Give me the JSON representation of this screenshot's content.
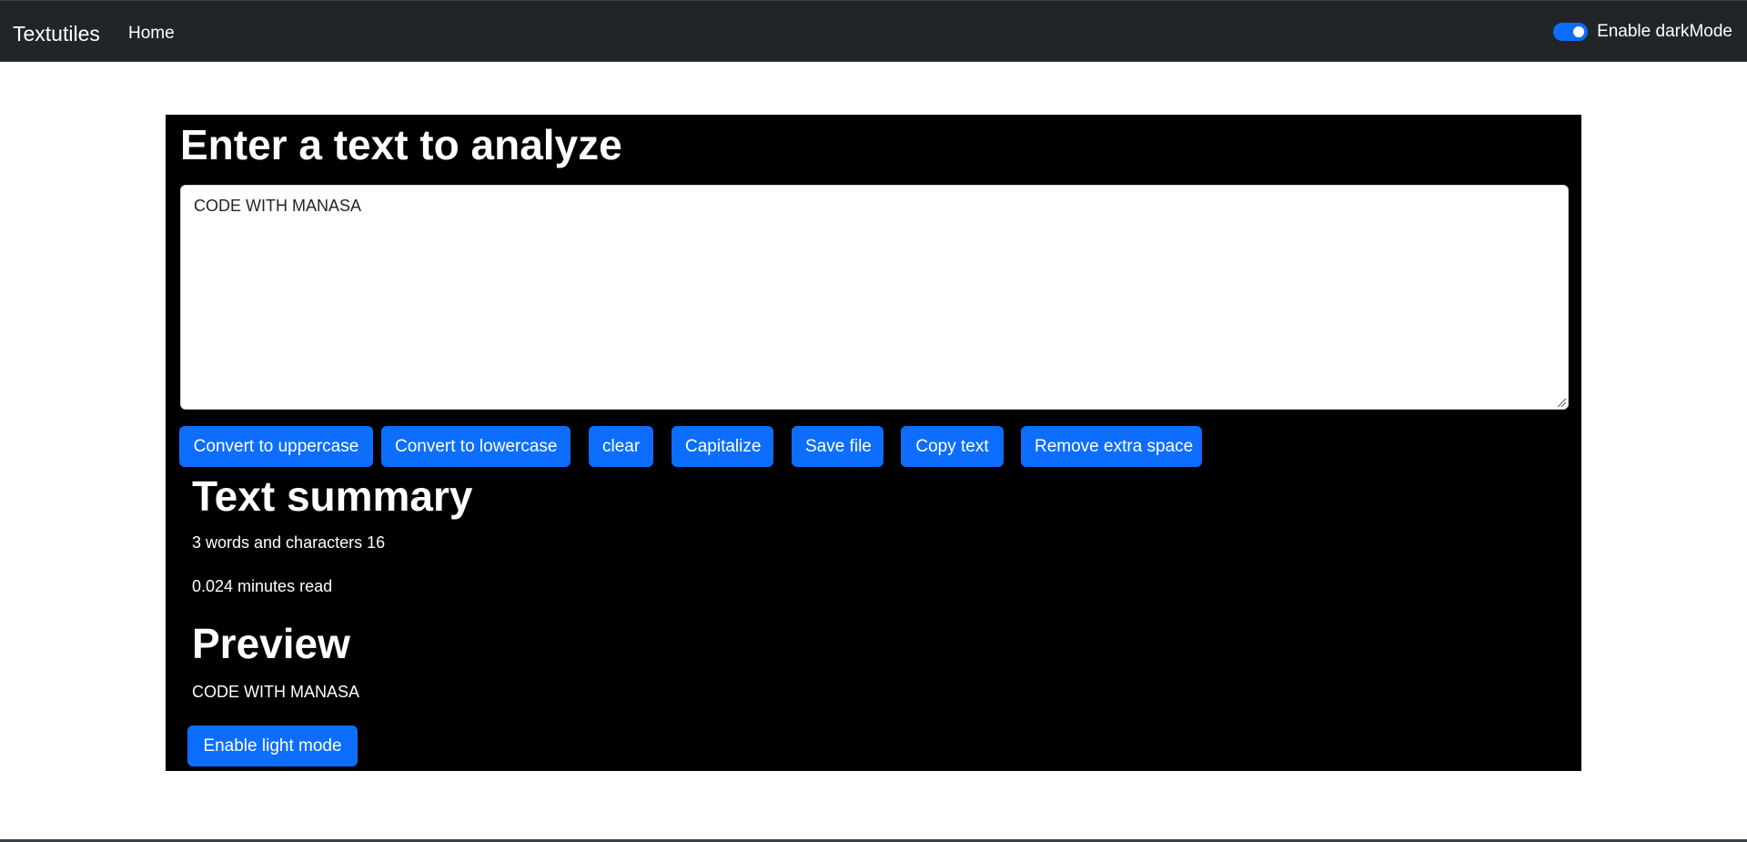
{
  "navbar": {
    "brand": "Textutiles",
    "home_label": "Home",
    "dark_mode_label": "Enable darkMode",
    "dark_mode_enabled": true
  },
  "form": {
    "heading": "Enter a text to analyze",
    "text_value": "CODE WITH MANASA"
  },
  "buttons": {
    "uppercase": "Convert to uppercase",
    "lowercase": "Convert to lowercase",
    "clear": "clear",
    "capitalize": "Capitalize",
    "save": "Save file",
    "copy": "Copy text",
    "remove_space": "Remove extra space"
  },
  "summary": {
    "heading": "Text summary",
    "counts": "3 words and characters 16",
    "read_time": "0.024 minutes read"
  },
  "preview": {
    "heading": "Preview",
    "text": "CODE WITH MANASA"
  },
  "light_mode_button": "Enable light mode",
  "colors": {
    "navbar_bg": "#212529",
    "panel_bg": "#000000",
    "primary": "#0d6efd"
  }
}
